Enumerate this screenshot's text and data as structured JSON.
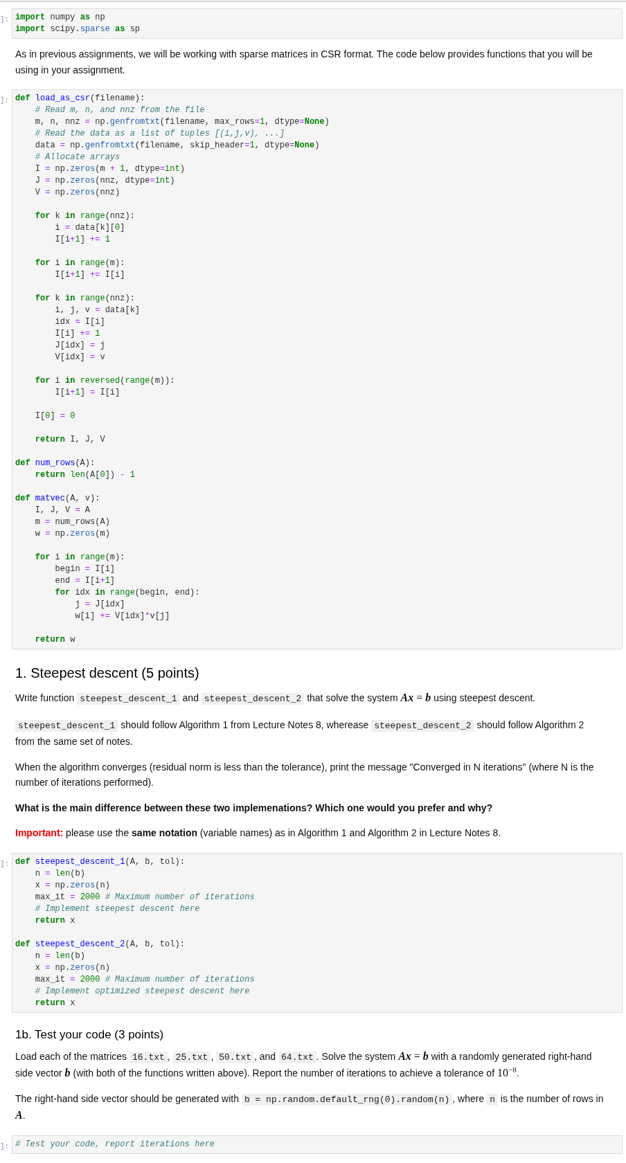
{
  "cells": [
    {
      "kind": "code",
      "prompt": "]:",
      "blocks": [
        [
          [
            {
              "kind": "keyword",
              "text": "import"
            },
            {
              "kind": "plain",
              "text": " numpy"
            },
            {
              "kind": "keyword",
              "text": " as"
            },
            {
              "kind": "plain",
              "text": " np"
            }
          ],
          [
            {
              "kind": "keyword",
              "text": "import"
            },
            {
              "kind": "plain",
              "text": " scipy."
            },
            {
              "kind": "attr",
              "text": "sparse"
            },
            {
              "kind": "keyword",
              "text": " as"
            },
            {
              "kind": "plain",
              "text": " sp"
            }
          ]
        ]
      ]
    },
    {
      "kind": "markdown",
      "items": [
        {
          "kind": "text",
          "runs": [
            {
              "kind": "plain",
              "text": "As in previous assignments, we will be working with sparse matrices in CSR format. The code below provides functions that you will be using in your assignment."
            }
          ]
        }
      ]
    },
    {
      "kind": "code",
      "prompt": "]:",
      "blocks": [
        [
          [
            {
              "kind": "keyword",
              "text": "def"
            },
            {
              "kind": "defname",
              "text": " load_as_csr"
            },
            {
              "kind": "plain",
              "text": "(filename):"
            }
          ],
          [
            {
              "kind": "comment",
              "text": "    # Read m, n, and nnz from the file"
            }
          ],
          [
            {
              "kind": "plain",
              "text": "    m, n, nnz"
            },
            {
              "kind": "op",
              "text": " ="
            },
            {
              "kind": "plain",
              "text": " np."
            },
            {
              "kind": "attr",
              "text": "genfromtxt"
            },
            {
              "kind": "plain",
              "text": "(filename, max_rows"
            },
            {
              "kind": "op",
              "text": "="
            },
            {
              "kind": "number",
              "text": "1"
            },
            {
              "kind": "plain",
              "text": ", dtype"
            },
            {
              "kind": "op",
              "text": "="
            },
            {
              "kind": "keyword",
              "text": "None"
            },
            {
              "kind": "plain",
              "text": ")"
            }
          ],
          [
            {
              "kind": "comment",
              "text": "    # Read the data as a list of tuples [(i,j,v), ...]"
            }
          ],
          [
            {
              "kind": "plain",
              "text": "    data"
            },
            {
              "kind": "op",
              "text": " ="
            },
            {
              "kind": "plain",
              "text": " np."
            },
            {
              "kind": "attr",
              "text": "genfromtxt"
            },
            {
              "kind": "plain",
              "text": "(filename, skip_header"
            },
            {
              "kind": "op",
              "text": "="
            },
            {
              "kind": "number",
              "text": "1"
            },
            {
              "kind": "plain",
              "text": ", dtype"
            },
            {
              "kind": "op",
              "text": "="
            },
            {
              "kind": "keyword",
              "text": "None"
            },
            {
              "kind": "plain",
              "text": ")"
            }
          ],
          [
            {
              "kind": "comment",
              "text": "    # Allocate arrays"
            }
          ],
          [
            {
              "kind": "plain",
              "text": "    I"
            },
            {
              "kind": "op",
              "text": " ="
            },
            {
              "kind": "plain",
              "text": " np."
            },
            {
              "kind": "attr",
              "text": "zeros"
            },
            {
              "kind": "plain",
              "text": "(m"
            },
            {
              "kind": "op",
              "text": " +"
            },
            {
              "kind": "number",
              "text": " 1"
            },
            {
              "kind": "plain",
              "text": ", dtype"
            },
            {
              "kind": "op",
              "text": "="
            },
            {
              "kind": "builtin",
              "text": "int"
            },
            {
              "kind": "plain",
              "text": ")"
            }
          ],
          [
            {
              "kind": "plain",
              "text": "    J"
            },
            {
              "kind": "op",
              "text": " ="
            },
            {
              "kind": "plain",
              "text": " np."
            },
            {
              "kind": "attr",
              "text": "zeros"
            },
            {
              "kind": "plain",
              "text": "(nnz, dtype"
            },
            {
              "kind": "op",
              "text": "="
            },
            {
              "kind": "builtin",
              "text": "int"
            },
            {
              "kind": "plain",
              "text": ")"
            }
          ],
          [
            {
              "kind": "plain",
              "text": "    V"
            },
            {
              "kind": "op",
              "text": " ="
            },
            {
              "kind": "plain",
              "text": " np."
            },
            {
              "kind": "attr",
              "text": "zeros"
            },
            {
              "kind": "plain",
              "text": "(nnz)"
            }
          ]
        ],
        [
          [
            {
              "kind": "keyword",
              "text": "    for"
            },
            {
              "kind": "plain",
              "text": " k"
            },
            {
              "kind": "keyword",
              "text": " in"
            },
            {
              "kind": "builtin",
              "text": " range"
            },
            {
              "kind": "plain",
              "text": "(nnz):"
            }
          ],
          [
            {
              "kind": "plain",
              "text": "        i"
            },
            {
              "kind": "op",
              "text": " ="
            },
            {
              "kind": "plain",
              "text": " data[k]["
            },
            {
              "kind": "number",
              "text": "0"
            },
            {
              "kind": "plain",
              "text": "]"
            }
          ],
          [
            {
              "kind": "plain",
              "text": "        I[i"
            },
            {
              "kind": "op",
              "text": "+"
            },
            {
              "kind": "number",
              "text": "1"
            },
            {
              "kind": "plain",
              "text": "]"
            },
            {
              "kind": "op",
              "text": " +="
            },
            {
              "kind": "number",
              "text": " 1"
            }
          ]
        ],
        [
          [
            {
              "kind": "keyword",
              "text": "    for"
            },
            {
              "kind": "plain",
              "text": " i"
            },
            {
              "kind": "keyword",
              "text": " in"
            },
            {
              "kind": "builtin",
              "text": " range"
            },
            {
              "kind": "plain",
              "text": "(m):"
            }
          ],
          [
            {
              "kind": "plain",
              "text": "        I[i"
            },
            {
              "kind": "op",
              "text": "+"
            },
            {
              "kind": "number",
              "text": "1"
            },
            {
              "kind": "plain",
              "text": "]"
            },
            {
              "kind": "op",
              "text": " +="
            },
            {
              "kind": "plain",
              "text": " I[i]"
            }
          ]
        ],
        [
          [
            {
              "kind": "keyword",
              "text": "    for"
            },
            {
              "kind": "plain",
              "text": " k"
            },
            {
              "kind": "keyword",
              "text": " in"
            },
            {
              "kind": "builtin",
              "text": " range"
            },
            {
              "kind": "plain",
              "text": "(nnz):"
            }
          ],
          [
            {
              "kind": "plain",
              "text": "        i, j, v"
            },
            {
              "kind": "op",
              "text": " ="
            },
            {
              "kind": "plain",
              "text": " data[k]"
            }
          ],
          [
            {
              "kind": "plain",
              "text": "        idx"
            },
            {
              "kind": "op",
              "text": " ="
            },
            {
              "kind": "plain",
              "text": " I[i]"
            }
          ],
          [
            {
              "kind": "plain",
              "text": "        I[i]"
            },
            {
              "kind": "op",
              "text": " +="
            },
            {
              "kind": "number",
              "text": " 1"
            }
          ],
          [
            {
              "kind": "plain",
              "text": "        J[idx]"
            },
            {
              "kind": "op",
              "text": " ="
            },
            {
              "kind": "plain",
              "text": " j"
            }
          ],
          [
            {
              "kind": "plain",
              "text": "        V[idx]"
            },
            {
              "kind": "op",
              "text": " ="
            },
            {
              "kind": "plain",
              "text": " v"
            }
          ]
        ],
        [
          [
            {
              "kind": "keyword",
              "text": "    for"
            },
            {
              "kind": "plain",
              "text": " i"
            },
            {
              "kind": "keyword",
              "text": " in"
            },
            {
              "kind": "builtin",
              "text": " reversed"
            },
            {
              "kind": "plain",
              "text": "("
            },
            {
              "kind": "builtin",
              "text": "range"
            },
            {
              "kind": "plain",
              "text": "(m)):"
            }
          ],
          [
            {
              "kind": "plain",
              "text": "        I[i"
            },
            {
              "kind": "op",
              "text": "+"
            },
            {
              "kind": "number",
              "text": "1"
            },
            {
              "kind": "plain",
              "text": "]"
            },
            {
              "kind": "op",
              "text": " ="
            },
            {
              "kind": "plain",
              "text": " I[i]"
            }
          ]
        ],
        [
          [
            {
              "kind": "plain",
              "text": "    I["
            },
            {
              "kind": "number",
              "text": "0"
            },
            {
              "kind": "plain",
              "text": "]"
            },
            {
              "kind": "op",
              "text": " ="
            },
            {
              "kind": "number",
              "text": " 0"
            }
          ]
        ],
        [
          [
            {
              "kind": "keyword",
              "text": "    return"
            },
            {
              "kind": "plain",
              "text": " I, J, V"
            }
          ]
        ],
        [
          [
            {
              "kind": "keyword",
              "text": "def"
            },
            {
              "kind": "defname",
              "text": " num_rows"
            },
            {
              "kind": "plain",
              "text": "(A):"
            }
          ],
          [
            {
              "kind": "keyword",
              "text": "    return"
            },
            {
              "kind": "builtin",
              "text": " len"
            },
            {
              "kind": "plain",
              "text": "(A["
            },
            {
              "kind": "number",
              "text": "0"
            },
            {
              "kind": "plain",
              "text": "])"
            },
            {
              "kind": "op",
              "text": " -"
            },
            {
              "kind": "number",
              "text": " 1"
            }
          ]
        ],
        [
          [
            {
              "kind": "keyword",
              "text": "def"
            },
            {
              "kind": "defname",
              "text": " matvec"
            },
            {
              "kind": "plain",
              "text": "(A, v):"
            }
          ],
          [
            {
              "kind": "plain",
              "text": "    I, J, V"
            },
            {
              "kind": "op",
              "text": " ="
            },
            {
              "kind": "plain",
              "text": " A"
            }
          ],
          [
            {
              "kind": "plain",
              "text": "    m"
            },
            {
              "kind": "op",
              "text": " ="
            },
            {
              "kind": "plain",
              "text": " num_rows(A)"
            }
          ],
          [
            {
              "kind": "plain",
              "text": "    w"
            },
            {
              "kind": "op",
              "text": " ="
            },
            {
              "kind": "plain",
              "text": " np."
            },
            {
              "kind": "attr",
              "text": "zeros"
            },
            {
              "kind": "plain",
              "text": "(m)"
            }
          ]
        ],
        [
          [
            {
              "kind": "keyword",
              "text": "    for"
            },
            {
              "kind": "plain",
              "text": " i"
            },
            {
              "kind": "keyword",
              "text": " in"
            },
            {
              "kind": "builtin",
              "text": " range"
            },
            {
              "kind": "plain",
              "text": "(m):"
            }
          ],
          [
            {
              "kind": "plain",
              "text": "        begin"
            },
            {
              "kind": "op",
              "text": " ="
            },
            {
              "kind": "plain",
              "text": " I[i]"
            }
          ],
          [
            {
              "kind": "plain",
              "text": "        end"
            },
            {
              "kind": "op",
              "text": " ="
            },
            {
              "kind": "plain",
              "text": " I[i"
            },
            {
              "kind": "op",
              "text": "+"
            },
            {
              "kind": "number",
              "text": "1"
            },
            {
              "kind": "plain",
              "text": "]"
            }
          ],
          [
            {
              "kind": "keyword",
              "text": "        for"
            },
            {
              "kind": "plain",
              "text": " idx"
            },
            {
              "kind": "keyword",
              "text": " in"
            },
            {
              "kind": "builtin",
              "text": " range"
            },
            {
              "kind": "plain",
              "text": "(begin, end):"
            }
          ],
          [
            {
              "kind": "plain",
              "text": "            j"
            },
            {
              "kind": "op",
              "text": " ="
            },
            {
              "kind": "plain",
              "text": " J[idx]"
            }
          ],
          [
            {
              "kind": "plain",
              "text": "            w[i]"
            },
            {
              "kind": "op",
              "text": " +="
            },
            {
              "kind": "plain",
              "text": " V[idx]"
            },
            {
              "kind": "op",
              "text": "*"
            },
            {
              "kind": "plain",
              "text": "v[j]"
            }
          ]
        ],
        [
          [
            {
              "kind": "keyword",
              "text": "    return"
            },
            {
              "kind": "plain",
              "text": " w"
            }
          ]
        ]
      ]
    },
    {
      "kind": "markdown",
      "items": [
        {
          "kind": "heading",
          "text": "1. Steepest descent (5 points)"
        },
        {
          "kind": "text",
          "runs": [
            {
              "kind": "plain",
              "text": "Write function "
            },
            {
              "kind": "code",
              "text": "steepest_descent_1"
            },
            {
              "kind": "plain",
              "text": " and "
            },
            {
              "kind": "code",
              "text": "steepest_descent_2"
            },
            {
              "kind": "plain",
              "text": " that solve the system "
            },
            {
              "kind": "math",
              "text": "*Ax* = *b*"
            },
            {
              "kind": "plain",
              "text": " using steepest descent."
            }
          ]
        },
        {
          "kind": "text",
          "runs": [
            {
              "kind": "code",
              "text": "steepest_descent_1"
            },
            {
              "kind": "plain",
              "text": " should follow Algorithm 1 from Lecture Notes 8, wherease "
            },
            {
              "kind": "code",
              "text": "steepest_descent_2"
            },
            {
              "kind": "plain",
              "text": " should follow Algorithm 2 from the same set of notes."
            }
          ]
        },
        {
          "kind": "text",
          "runs": [
            {
              "kind": "plain",
              "text": "When the algorithm converges (residual norm is less than the tolerance), print the message \"Converged in N iterations\" (where N is the number of iterations performed)."
            }
          ]
        },
        {
          "kind": "bold",
          "text": "What is the main difference between these two implemenations? Which one would you prefer and why?"
        },
        {
          "kind": "text",
          "runs": [
            {
              "kind": "alert",
              "text": "Important:"
            },
            {
              "kind": "plain",
              "text": " please use the **same notation** (variable names) as in Algorithm 1 and Algorithm 2 in Lecture Notes 8."
            }
          ]
        }
      ]
    },
    {
      "kind": "code",
      "prompt": "]:",
      "blocks": [
        [
          [
            {
              "kind": "keyword",
              "text": "def"
            },
            {
              "kind": "defname",
              "text": " steepest_descent_1"
            },
            {
              "kind": "plain",
              "text": "(A, b, tol):"
            }
          ],
          [
            {
              "kind": "plain",
              "text": "    n"
            },
            {
              "kind": "op",
              "text": " ="
            },
            {
              "kind": "builtin",
              "text": " len"
            },
            {
              "kind": "plain",
              "text": "(b)"
            }
          ],
          [
            {
              "kind": "plain",
              "text": "    x"
            },
            {
              "kind": "op",
              "text": " ="
            },
            {
              "kind": "plain",
              "text": " np."
            },
            {
              "kind": "attr",
              "text": "zeros"
            },
            {
              "kind": "plain",
              "text": "(n)"
            }
          ],
          [
            {
              "kind": "plain",
              "text": "    max_it"
            },
            {
              "kind": "op",
              "text": " ="
            },
            {
              "kind": "number",
              "text": " 2000"
            },
            {
              "kind": "comment",
              "text": " # Maximum number of iterations"
            }
          ],
          [
            {
              "kind": "comment",
              "text": "    # Implement steepest descent here"
            }
          ],
          [
            {
              "kind": "keyword",
              "text": "    return"
            },
            {
              "kind": "plain",
              "text": " x"
            }
          ]
        ],
        [
          [
            {
              "kind": "keyword",
              "text": "def"
            },
            {
              "kind": "defname",
              "text": " steepest_descent_2"
            },
            {
              "kind": "plain",
              "text": "(A, b, tol):"
            }
          ],
          [
            {
              "kind": "plain",
              "text": "    n"
            },
            {
              "kind": "op",
              "text": " ="
            },
            {
              "kind": "builtin",
              "text": " len"
            },
            {
              "kind": "plain",
              "text": "(b)"
            }
          ],
          [
            {
              "kind": "plain",
              "text": "    x"
            },
            {
              "kind": "op",
              "text": " ="
            },
            {
              "kind": "plain",
              "text": " np."
            },
            {
              "kind": "attr",
              "text": "zeros"
            },
            {
              "kind": "plain",
              "text": "(n)"
            }
          ],
          [
            {
              "kind": "plain",
              "text": "    max_it"
            },
            {
              "kind": "op",
              "text": " ="
            },
            {
              "kind": "number",
              "text": " 2000"
            },
            {
              "kind": "comment",
              "text": " # Maximum number of iterations"
            }
          ],
          [
            {
              "kind": "comment",
              "text": "    # Implement optimized steepest descent here"
            }
          ],
          [
            {
              "kind": "keyword",
              "text": "    return"
            },
            {
              "kind": "plain",
              "text": " x"
            }
          ]
        ]
      ]
    },
    {
      "kind": "markdown",
      "items": [
        {
          "kind": "subheading",
          "text": "1b. Test your code (3 points)"
        },
        {
          "kind": "text",
          "runs": [
            {
              "kind": "plain",
              "text": "Load each of the matrices "
            },
            {
              "kind": "code",
              "text": "16.txt"
            },
            {
              "kind": "plain",
              "text": ", "
            },
            {
              "kind": "code",
              "text": "25.txt"
            },
            {
              "kind": "plain",
              "text": ", "
            },
            {
              "kind": "code",
              "text": "50.txt"
            },
            {
              "kind": "plain",
              "text": ", and "
            },
            {
              "kind": "code",
              "text": "64.txt"
            },
            {
              "kind": "plain",
              "text": ". Solve the system "
            },
            {
              "kind": "math",
              "text": "*Ax* = *b*"
            },
            {
              "kind": "plain",
              "text": " with a randomly generated right-hand side vector "
            },
            {
              "kind": "var",
              "text": "b"
            },
            {
              "kind": "plain",
              "text": " (with both of the functions written above). Report the number of iterations to achieve a tolerance of "
            },
            {
              "kind": "math",
              "text": "10$^{−8}$"
            },
            {
              "kind": "plain",
              "text": "."
            }
          ]
        },
        {
          "kind": "text",
          "runs": [
            {
              "kind": "plain",
              "text": "The right-hand side vector should be generated with "
            },
            {
              "kind": "code",
              "text": "b = np.random.default_rng(0).random(n)"
            },
            {
              "kind": "plain",
              "text": ", where "
            },
            {
              "kind": "code",
              "text": "n"
            },
            {
              "kind": "plain",
              "text": " is the number of rows in "
            },
            {
              "kind": "var",
              "text": "A"
            },
            {
              "kind": "plain",
              "text": "."
            }
          ]
        }
      ]
    },
    {
      "kind": "code",
      "prompt": "]:",
      "blocks": [
        [
          [
            {
              "kind": "comment",
              "text": "# Test your code, report iterations here"
            }
          ]
        ]
      ]
    }
  ]
}
